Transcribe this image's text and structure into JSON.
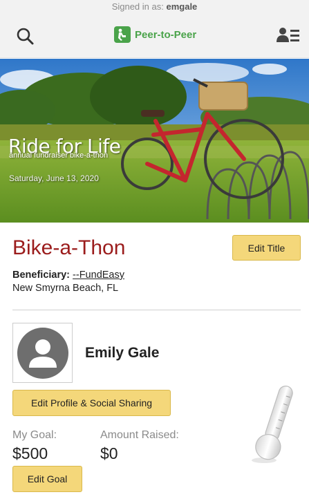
{
  "header": {
    "signed_in_prefix": "Signed in as:",
    "username": "emgale",
    "brand_name": "Peer-to-Peer",
    "brand_color": "#4aa34a",
    "search_icon": "search-icon",
    "profile_icon": "user-list-icon"
  },
  "banner": {
    "title": "Ride for Life",
    "subtitle": "annual fundraiser bike-a-thon",
    "date": "Saturday, June 13, 2020"
  },
  "event": {
    "title": "Bike-a-Thon",
    "title_color": "#9b1c1c",
    "edit_title_label": "Edit Title",
    "beneficiary_label": "Beneficiary:",
    "beneficiary_value": "--FundEasy",
    "location": "New Smyrna Beach, FL"
  },
  "participant": {
    "name": "Emily Gale",
    "avatar_icon": "avatar-placeholder-icon",
    "edit_profile_label": "Edit Profile & Social Sharing"
  },
  "goal": {
    "goal_label": "My Goal:",
    "goal_value": "$500",
    "raised_label": "Amount Raised:",
    "raised_value": "$0",
    "edit_goal_label": "Edit Goal",
    "progress_fraction": 0
  },
  "colors": {
    "button_bg": "#f4d77a"
  }
}
